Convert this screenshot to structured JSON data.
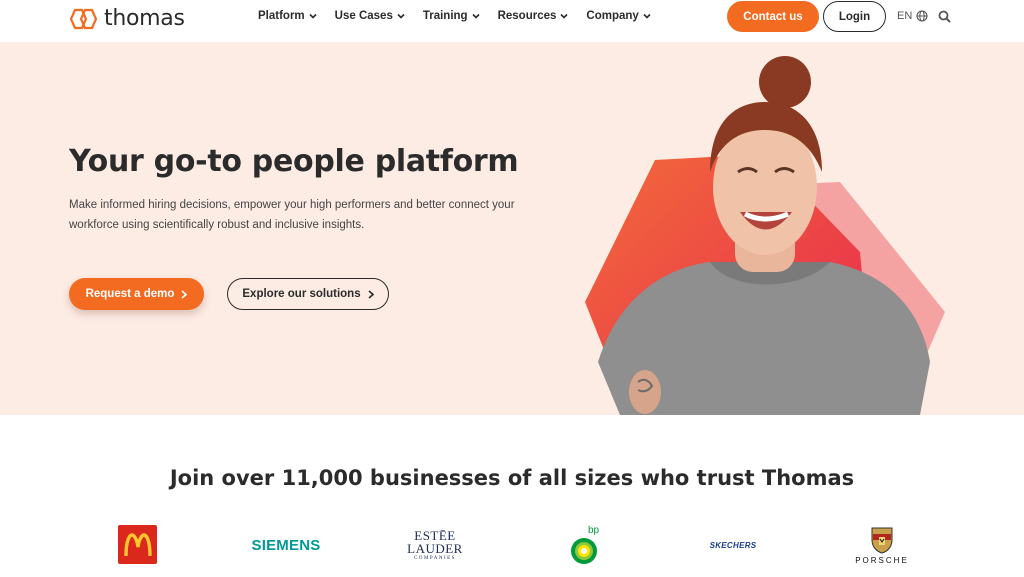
{
  "header": {
    "logo_text": "thomas",
    "nav": [
      {
        "label": "Platform"
      },
      {
        "label": "Use Cases"
      },
      {
        "label": "Training"
      },
      {
        "label": "Resources"
      },
      {
        "label": "Company"
      }
    ],
    "contact_label": "Contact us",
    "login_label": "Login",
    "language": "EN"
  },
  "hero": {
    "title": "Your go-to people platform",
    "subtitle": "Make informed hiring decisions, empower your high performers and better connect your workforce using scientifically robust and inclusive insights.",
    "primary_cta": "Request a demo",
    "secondary_cta": "Explore our solutions"
  },
  "trust": {
    "title": "Join over 11,000 businesses of all sizes who trust Thomas",
    "logos": {
      "siemens": "SIEMENS",
      "estee_line1": "ESTĒE",
      "estee_line2": "LAUDER",
      "estee_line3": "COMPANIES",
      "bp": "bp",
      "skechers": "SKECHERS",
      "porsche": "PORSCHE"
    }
  },
  "colors": {
    "accent": "#f26b21",
    "hero_bg": "#fdece4",
    "text": "#2b2b2b"
  }
}
